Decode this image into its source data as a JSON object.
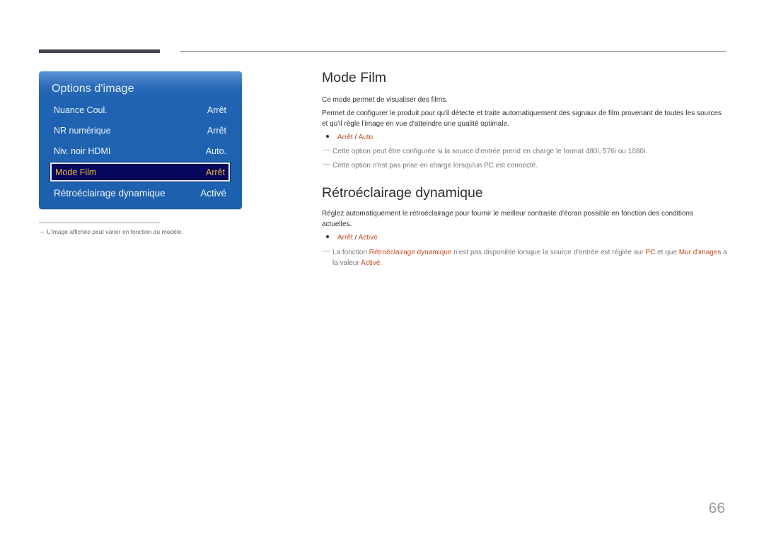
{
  "osd": {
    "title": "Options d'image",
    "items": [
      {
        "label": "Nuance Coul.",
        "value": "Arrêt",
        "selected": false
      },
      {
        "label": "NR numérique",
        "value": "Arrêt",
        "selected": false
      },
      {
        "label": "Niv. noir HDMI",
        "value": "Auto.",
        "selected": false
      },
      {
        "label": "Mode Film",
        "value": "Arrêt",
        "selected": true
      },
      {
        "label": "Rétroéclairage dynamique",
        "value": "Activé",
        "selected": false
      }
    ],
    "colors": {
      "panel": "#1d60ae",
      "selected_bg": "#06065c",
      "selected_text": "#e7b63a"
    }
  },
  "footnote": {
    "dash": "–",
    "text": "L'image affichée peut varier en fonction du modèle."
  },
  "sections": [
    {
      "title": "Mode Film",
      "paragraphs": [
        "Ce mode permet de visualiser des films.",
        "Permet de configurer le produit pour qu'il détecte et traite automatiquement des signaux de film provenant de toutes les sources et qu'il règle l'image en vue d'atteindre une qualité optimale."
      ],
      "options": {
        "first": "Arrêt",
        "separator": " / ",
        "second": "Auto."
      },
      "notes": [
        "Cette option peut être configurée si la source d'entrée prend en charge le format 480i, 576i ou 1080i.",
        "Cette option n'est pas prise en charge lorsqu'un PC est connecté."
      ]
    },
    {
      "title": "Rétroéclairage dynamique",
      "paragraphs": [
        "Réglez automatiquement le rétroéclairage pour fournir le meilleur contraste d'écran possible en fonction des conditions actuelles."
      ],
      "options": {
        "first": "Arrêt",
        "separator": " / ",
        "second": "Activé"
      },
      "note_parts": {
        "p1": "La fonction ",
        "h1": "Rétroéclairage dynamique",
        "p2": " n'est pas disponible lorsque la source d'entrée est réglée sur ",
        "h2": "PC",
        "p3": " et que ",
        "h3": "Mur d'images",
        "p4": " a la valeur ",
        "h4": "Activé",
        "p5": "."
      }
    }
  ],
  "note_dash": "―",
  "accent_color": "#c14a1d",
  "page_number": "66"
}
